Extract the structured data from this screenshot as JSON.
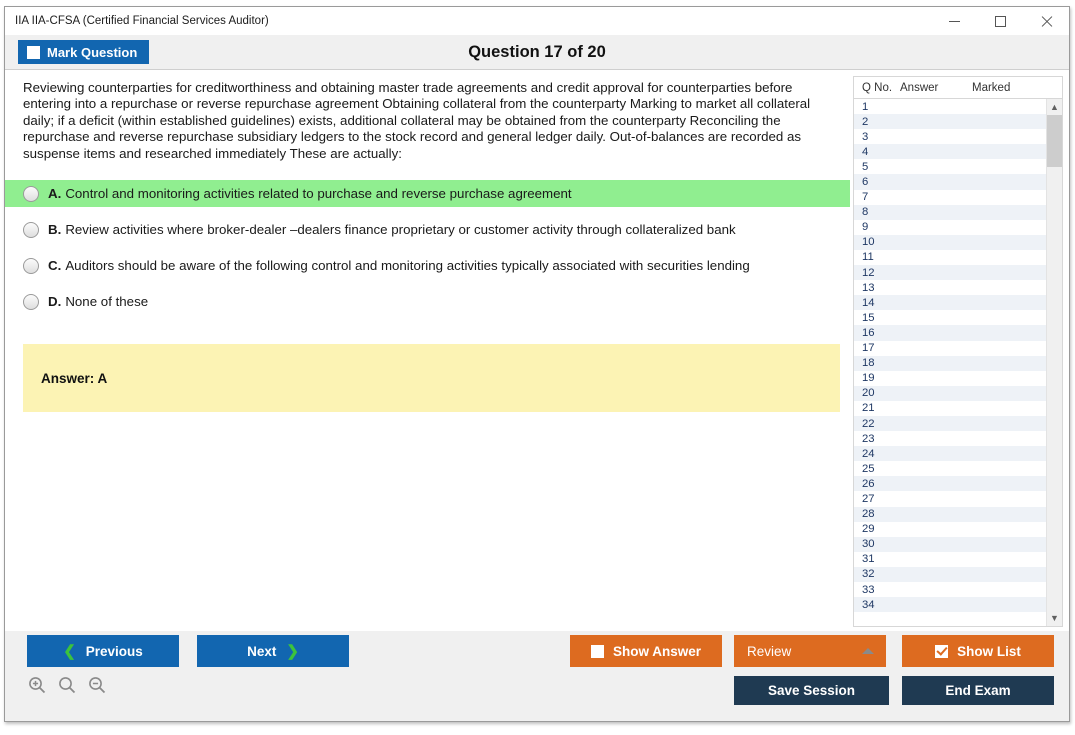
{
  "window": {
    "title": "IIA IIA-CFSA (Certified Financial Services Auditor)",
    "controls": {
      "minimize": "minimize-icon",
      "maximize": "maximize-icon",
      "close": "close-icon"
    }
  },
  "header": {
    "mark_question_label": "Mark Question",
    "question_counter": "Question 17 of 20",
    "current_question": 17,
    "total_questions": 20
  },
  "question": {
    "text": "Reviewing counterparties for creditworthiness and obtaining master trade agreements and credit approval for counterparties before entering into a repurchase or reverse repurchase agreement Obtaining collateral from the counterparty Marking to market all collateral daily; if a deficit (within established guidelines) exists, additional collateral may be obtained from the counterparty Reconciling the repurchase and reverse repurchase subsidiary ledgers to the stock record and general ledger daily. Out-of-balances are recorded as suspense items and researched immediately These are actually:",
    "options": [
      {
        "letter": "A.",
        "text": "Control and monitoring activities related to purchase and reverse purchase agreement",
        "correct": true
      },
      {
        "letter": "B.",
        "text": "Review activities where broker-dealer –dealers finance proprietary or customer activity through collateralized bank",
        "correct": false
      },
      {
        "letter": "C.",
        "text": "Auditors should be aware of the following control and monitoring activities typically associated with securities lending",
        "correct": false
      },
      {
        "letter": "D.",
        "text": "None of these",
        "correct": false
      }
    ],
    "answer_label": "Answer: A"
  },
  "list_panel": {
    "columns": [
      "Q No.",
      "Answer",
      "Marked"
    ],
    "rows": [
      {
        "qno": "1",
        "answer": "",
        "marked": ""
      },
      {
        "qno": "2",
        "answer": "",
        "marked": ""
      },
      {
        "qno": "3",
        "answer": "",
        "marked": ""
      },
      {
        "qno": "4",
        "answer": "",
        "marked": ""
      },
      {
        "qno": "5",
        "answer": "",
        "marked": ""
      },
      {
        "qno": "6",
        "answer": "",
        "marked": ""
      },
      {
        "qno": "7",
        "answer": "",
        "marked": ""
      },
      {
        "qno": "8",
        "answer": "",
        "marked": ""
      },
      {
        "qno": "9",
        "answer": "",
        "marked": ""
      },
      {
        "qno": "10",
        "answer": "",
        "marked": ""
      },
      {
        "qno": "11",
        "answer": "",
        "marked": ""
      },
      {
        "qno": "12",
        "answer": "",
        "marked": ""
      },
      {
        "qno": "13",
        "answer": "",
        "marked": ""
      },
      {
        "qno": "14",
        "answer": "",
        "marked": ""
      },
      {
        "qno": "15",
        "answer": "",
        "marked": ""
      },
      {
        "qno": "16",
        "answer": "",
        "marked": ""
      },
      {
        "qno": "17",
        "answer": "",
        "marked": ""
      },
      {
        "qno": "18",
        "answer": "",
        "marked": ""
      },
      {
        "qno": "19",
        "answer": "",
        "marked": ""
      },
      {
        "qno": "20",
        "answer": "",
        "marked": ""
      },
      {
        "qno": "21",
        "answer": "",
        "marked": ""
      },
      {
        "qno": "22",
        "answer": "",
        "marked": ""
      },
      {
        "qno": "23",
        "answer": "",
        "marked": ""
      },
      {
        "qno": "24",
        "answer": "",
        "marked": ""
      },
      {
        "qno": "25",
        "answer": "",
        "marked": ""
      },
      {
        "qno": "26",
        "answer": "",
        "marked": ""
      },
      {
        "qno": "27",
        "answer": "",
        "marked": ""
      },
      {
        "qno": "28",
        "answer": "",
        "marked": ""
      },
      {
        "qno": "29",
        "answer": "",
        "marked": ""
      },
      {
        "qno": "30",
        "answer": "",
        "marked": ""
      },
      {
        "qno": "31",
        "answer": "",
        "marked": ""
      },
      {
        "qno": "32",
        "answer": "",
        "marked": ""
      },
      {
        "qno": "33",
        "answer": "",
        "marked": ""
      },
      {
        "qno": "34",
        "answer": "",
        "marked": ""
      }
    ],
    "scroll_up_icon": "chevron-up-icon",
    "scroll_down_icon": "chevron-down-icon"
  },
  "footer": {
    "previous_label": "Previous",
    "next_label": "Next",
    "show_answer_label": "Show Answer",
    "show_answer_checked": false,
    "review_label": "Review",
    "show_list_label": "Show List",
    "show_list_checked": true,
    "save_session_label": "Save Session",
    "end_exam_label": "End Exam",
    "zoom_in_icon": "zoom-in-icon",
    "zoom_reset_icon": "magnifier-icon",
    "zoom_out_icon": "zoom-out-icon"
  },
  "colors": {
    "primary_blue": "#1266b0",
    "orange": "#dd6b20",
    "dark_navy": "#1f3a52",
    "correct_green": "#90ee90",
    "answer_yellow": "#fcf3b4",
    "chevron_green": "#3cc33c"
  }
}
